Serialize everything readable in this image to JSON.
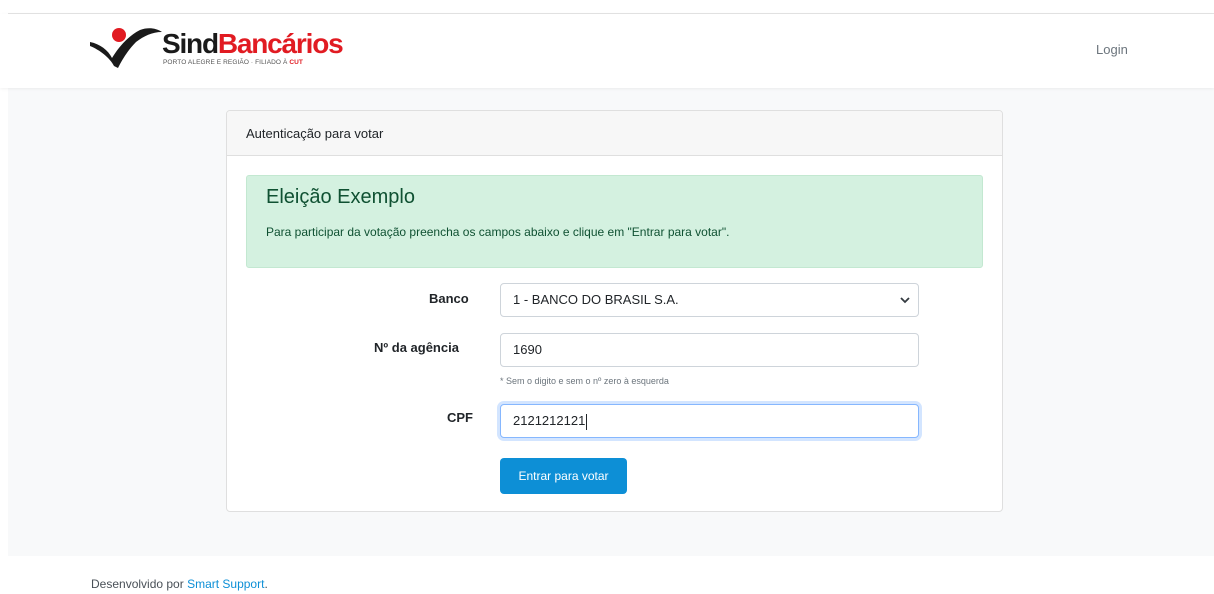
{
  "navbar": {
    "brand_prefix": "Sind",
    "brand_suffix": "Bancários",
    "brand_subtitle_main": "PORTO ALEGRE E REGIÃO · FILIADO À ",
    "brand_subtitle_bold": "CUT",
    "login_label": "Login"
  },
  "card": {
    "header": "Autenticação para votar",
    "alert": {
      "title": "Eleição Exemplo",
      "text": "Para participar da votação preencha os campos abaixo e clique em \"Entrar para votar\"."
    },
    "form": {
      "bank_label": "Banco",
      "bank_selected": "1 - BANCO DO BRASIL S.A.",
      "agency_label": "Nº da agência",
      "agency_value": "1690",
      "agency_hint": "* Sem o digito e sem o nº zero à esquerda",
      "cpf_label": "CPF",
      "cpf_value": "2121212121",
      "submit_label": "Entrar para votar"
    }
  },
  "footer": {
    "prefix": "Desenvolvido por ",
    "link": "Smart Support",
    "suffix": "."
  },
  "colors": {
    "primary": "#0d8fd6",
    "brand_red": "#e11b22",
    "alert_bg": "#d4f1e0",
    "alert_text": "#0f5132"
  },
  "icons": {
    "brand_logo": "sindbancarios-logo",
    "select_caret": "chevron-down-icon"
  }
}
